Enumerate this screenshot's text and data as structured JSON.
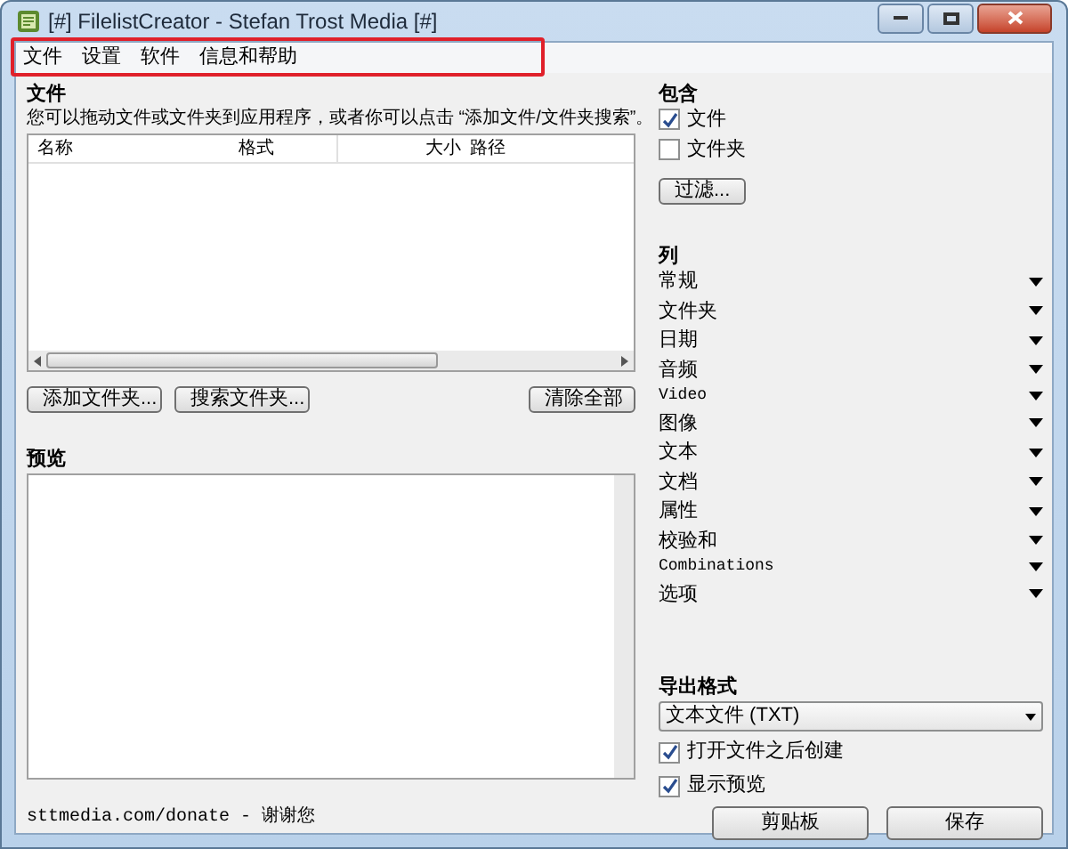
{
  "window": {
    "title": "[#] FilelistCreator - Stefan Trost Media [#]"
  },
  "menu": [
    "文件",
    "设置",
    "软件",
    "信息和帮助"
  ],
  "files": {
    "heading": "文件",
    "hint": "您可以拖动文件或文件夹到应用程序，或者你可以点击 “添加文件/文件夹搜索”。",
    "columns": [
      "名称",
      "格式",
      "大小",
      "路径"
    ],
    "buttons": [
      "添加文件夹...",
      "搜索文件夹...",
      "清除全部"
    ]
  },
  "preview": {
    "heading": "预览"
  },
  "footer": "sttmedia.com/donate - 谢谢您",
  "include": {
    "heading": "包含",
    "options": [
      {
        "label": "文件",
        "checked": true
      },
      {
        "label": "文件夹",
        "checked": false
      }
    ],
    "filter_button": "过滤..."
  },
  "columns_panel": {
    "heading": "列",
    "groups": [
      {
        "label": "常规",
        "kind": "cjk"
      },
      {
        "label": "文件夹",
        "kind": "cjk"
      },
      {
        "label": "日期",
        "kind": "cjk"
      },
      {
        "label": "音频",
        "kind": "cjk"
      },
      {
        "label": "Video",
        "kind": "latin"
      },
      {
        "label": "图像",
        "kind": "cjk"
      },
      {
        "label": "文本",
        "kind": "cjk"
      },
      {
        "label": "文档",
        "kind": "cjk"
      },
      {
        "label": "属性",
        "kind": "cjk"
      },
      {
        "label": "校验和",
        "kind": "cjk"
      },
      {
        "label": "Combinations",
        "kind": "latin"
      },
      {
        "label": "选项",
        "kind": "cjk"
      }
    ]
  },
  "export": {
    "heading": "导出格式",
    "format": "文本文件 (TXT)",
    "options": [
      {
        "label": "打开文件之后创建",
        "checked": true
      },
      {
        "label": "显示预览",
        "checked": true
      }
    ]
  },
  "actions": [
    "剪贴板",
    "保存"
  ]
}
